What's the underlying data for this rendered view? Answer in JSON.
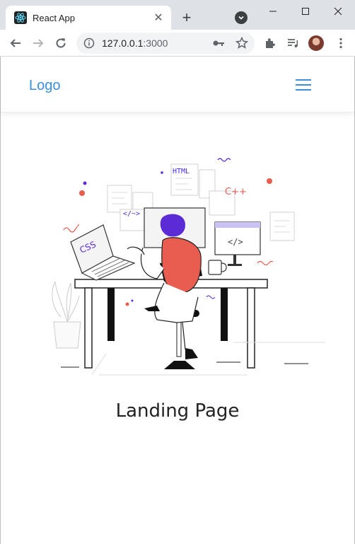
{
  "browser": {
    "tab_title": "React App",
    "tab_close": "✕",
    "new_tab": "+",
    "url_host": "127.0.0.1",
    "url_port": ":3000"
  },
  "app": {
    "logo": "Logo",
    "heading": "Landing Page"
  },
  "illustration_labels": {
    "html": "HTML",
    "cpp": "C++",
    "tag": "</~>",
    "css": "CSS",
    "code": "</>"
  },
  "colors": {
    "accent": "#3c8fe0",
    "purple": "#5b2bd6",
    "coral": "#e85d4f"
  }
}
